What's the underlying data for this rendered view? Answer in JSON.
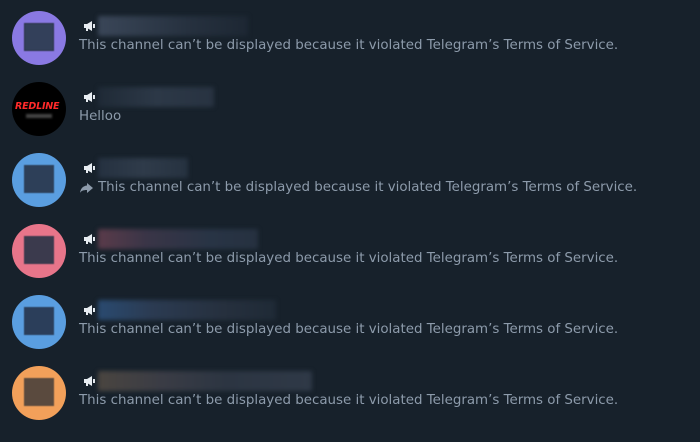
{
  "theme": {
    "background": "#17212b",
    "text_color": "#8d9bab",
    "icon_color": "#e8edf2"
  },
  "chats": [
    {
      "avatar_color": "#8a79e3",
      "avatar_image": "blurred-square",
      "name": "",
      "channel_icon": "megaphone-icon",
      "forwarded": false,
      "preview": "This channel can’t be displayed because it violated Telegram’s Terms of Service."
    },
    {
      "avatar_color": "#000000",
      "avatar_image": "redline-logo",
      "avatar_logo_text": "REDLINE",
      "name": "",
      "channel_icon": "megaphone-icon",
      "forwarded": false,
      "preview": "Helloo"
    },
    {
      "avatar_color": "#5a9ee0",
      "avatar_image": "blurred-square",
      "name": "",
      "channel_icon": "megaphone-icon",
      "forwarded": true,
      "forward_icon": "forward-arrow-icon",
      "preview": "This channel can’t be displayed because it violated Telegram’s Terms of Service."
    },
    {
      "avatar_color": "#e8758a",
      "avatar_image": "blurred-square",
      "name": "",
      "channel_icon": "megaphone-icon",
      "forwarded": false,
      "preview": "This channel can’t be displayed because it violated Telegram’s Terms of Service."
    },
    {
      "avatar_color": "#5a9ee0",
      "avatar_image": "blurred-square",
      "name": "",
      "channel_icon": "megaphone-icon",
      "forwarded": false,
      "preview": "This channel can’t be displayed because it violated Telegram’s Terms of Service."
    },
    {
      "avatar_color": "#f2a05a",
      "avatar_image": "blurred-square",
      "name": "",
      "channel_icon": "megaphone-icon",
      "forwarded": false,
      "preview": "This channel can’t be displayed because it violated Telegram’s Terms of Service."
    }
  ]
}
